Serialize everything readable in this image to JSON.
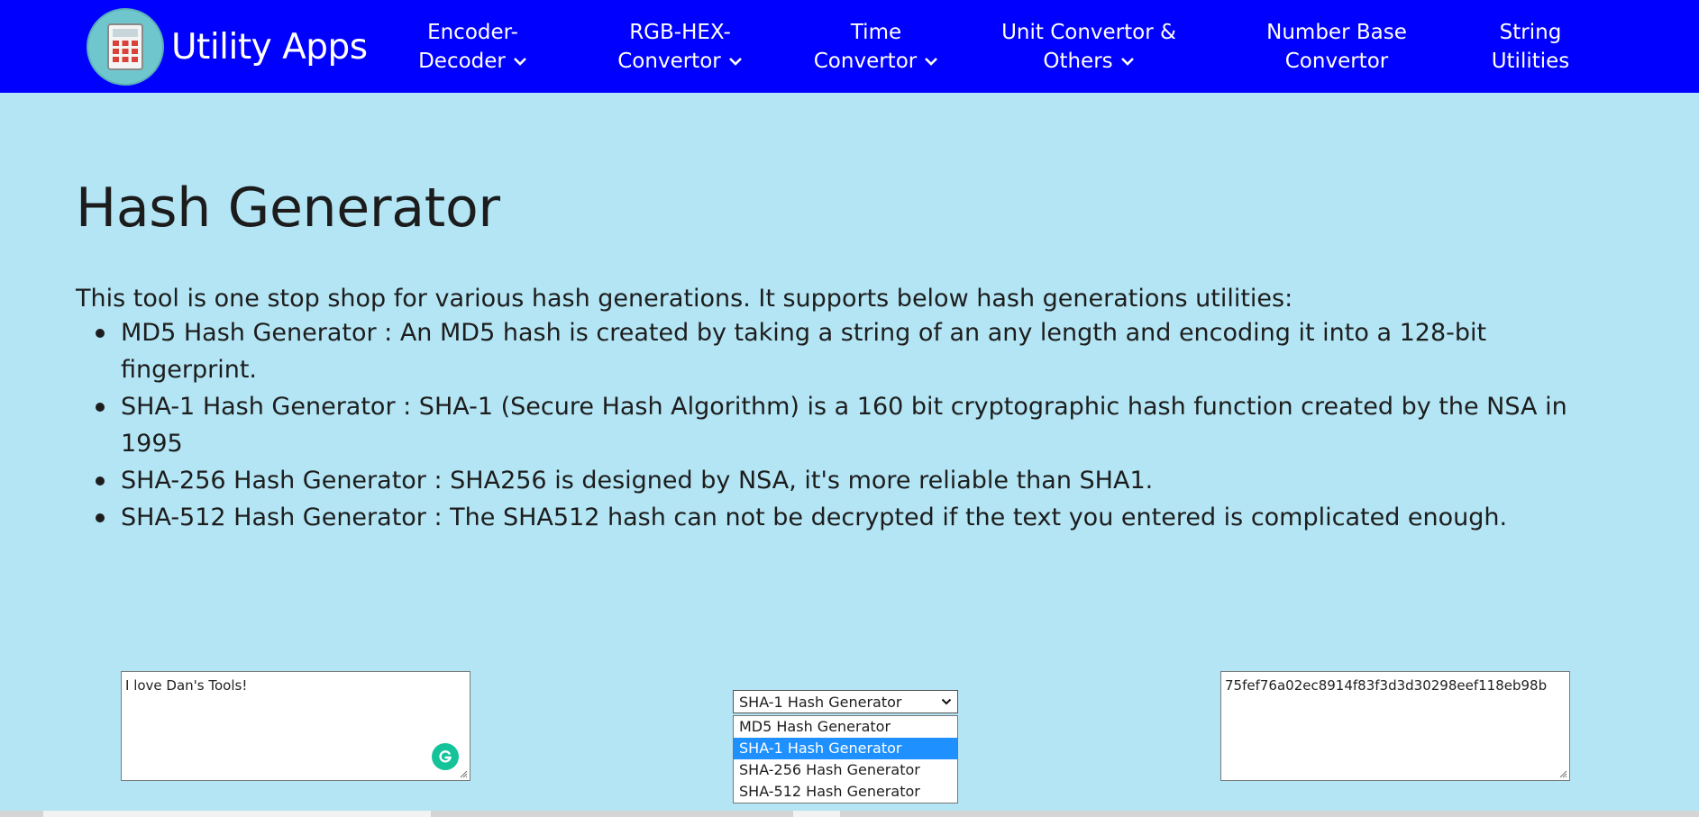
{
  "header": {
    "brand": "Utility Apps",
    "nav": [
      {
        "lines": [
          "Encoder-",
          "Decoder"
        ],
        "dropdown": true
      },
      {
        "lines": [
          "RGB-HEX-",
          "Convertor"
        ],
        "dropdown": true
      },
      {
        "lines": [
          "Time",
          "Convertor"
        ],
        "dropdown": true
      },
      {
        "lines": [
          "Unit Convertor &",
          "Others"
        ],
        "dropdown": true
      },
      {
        "lines": [
          "Number Base",
          "Convertor"
        ],
        "dropdown": false
      },
      {
        "lines": [
          "String",
          "Utilities"
        ],
        "dropdown": false
      }
    ]
  },
  "main": {
    "title": "Hash Generator",
    "intro": "This tool is one stop shop for various hash generations. It supports below hash generations utilities:",
    "features": [
      "MD5 Hash Generator : An MD5 hash is created by taking a string of an any length and encoding it into a 128-bit fingerprint.",
      "SHA-1 Hash Generator : SHA-1 (Secure Hash Algorithm) is a 160 bit cryptographic hash function created by the NSA in 1995",
      "SHA-256 Hash Generator : SHA256 is designed by NSA, it's more reliable than SHA1.",
      "SHA-512 Hash Generator : The SHA512 hash can not be decrypted if the text you entered is complicated enough."
    ]
  },
  "tool": {
    "input_text": "I love Dan's Tools!",
    "selected_algorithm": "SHA-1 Hash Generator",
    "options": [
      "MD5 Hash Generator",
      "SHA-1 Hash Generator",
      "SHA-256 Hash Generator",
      "SHA-512 Hash Generator"
    ],
    "selected_index": 1,
    "output_hash": "75fef76a02ec8914f83f3d3d30298eef118eb98b"
  },
  "colors": {
    "navbar": "#0000ff",
    "page_background": "#b3e5f4",
    "option_highlight": "#1e90ff",
    "grammarly": "#15c39a"
  }
}
